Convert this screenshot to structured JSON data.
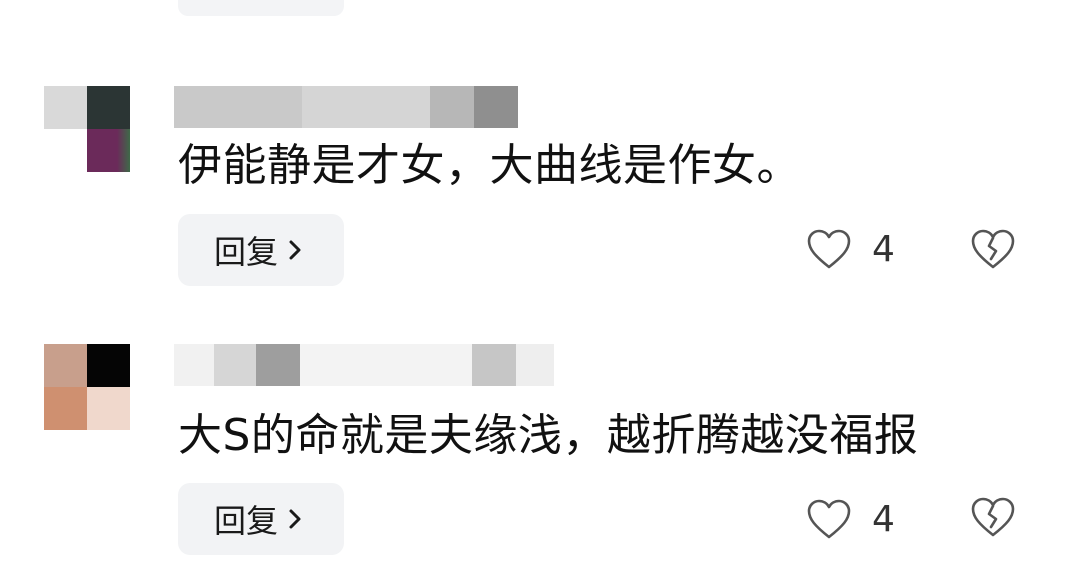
{
  "comments": [
    {
      "text": "伊能静是才女，大曲线是作女。",
      "reply_label": "回复",
      "like_count": "4"
    },
    {
      "text": "大S的命就是夫缘浅，越折腾越没福报",
      "reply_label": "回复",
      "like_count": "4"
    }
  ],
  "icons": {
    "like": "heart-outline-icon",
    "dislike": "broken-heart-icon",
    "reply_arrow": "chevron-right-icon"
  },
  "colors": {
    "button_bg": "#f2f3f5",
    "text": "#111111",
    "icon_stroke": "#444444"
  }
}
